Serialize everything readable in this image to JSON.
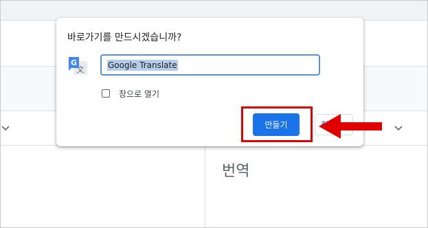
{
  "dialog": {
    "title": "바로가기를 만드시겠습니까?",
    "name_value": "Google Translate",
    "open_window_label": "창으로 열기",
    "create_label": "만들기",
    "cancel_label": "취소"
  },
  "background": {
    "output_label": "번역"
  },
  "annotation": {
    "highlight_color": "#e00000",
    "arrow_color": "#e00000"
  },
  "icons": {
    "app": "google-translate-icon",
    "chevron": "chevron-down-icon"
  }
}
